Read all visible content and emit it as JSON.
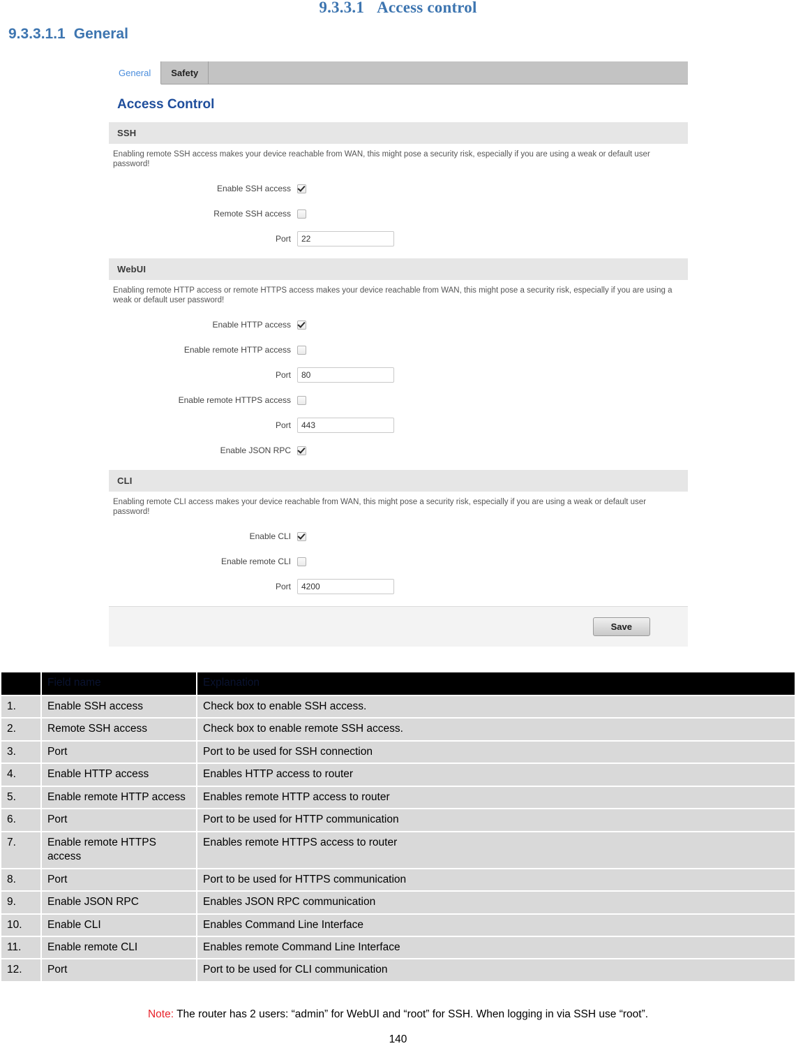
{
  "document": {
    "h1_number": "9.3.3.1",
    "h1_title": "Access control",
    "h2_number": "9.3.3.1.1",
    "h2_title": "General",
    "page_number": "140",
    "note_label": "Note:",
    "note_text": "The router has 2 users: “admin” for WebUI and “root” for SSH. When logging in via SSH use “root”."
  },
  "webui": {
    "tabs": [
      {
        "label": "General",
        "active": true
      },
      {
        "label": "Safety",
        "active": false
      }
    ],
    "panel_title": "Access Control",
    "save_label": "Save",
    "sections": [
      {
        "heading": "SSH",
        "note": "Enabling remote SSH access makes your device reachable from WAN, this might pose a security risk, especially if you are using a weak or default user password!",
        "fields": [
          {
            "label": "Enable SSH access",
            "type": "checkbox",
            "checked": true
          },
          {
            "label": "Remote SSH access",
            "type": "checkbox",
            "checked": false
          },
          {
            "label": "Port",
            "type": "text",
            "value": "22"
          }
        ]
      },
      {
        "heading": "WebUI",
        "note": "Enabling remote HTTP access or remote HTTPS access makes your device reachable from WAN, this might pose a security risk, especially if you are using a weak or default user password!",
        "fields": [
          {
            "label": "Enable HTTP access",
            "type": "checkbox",
            "checked": true
          },
          {
            "label": "Enable remote HTTP access",
            "type": "checkbox",
            "checked": false
          },
          {
            "label": "Port",
            "type": "text",
            "value": "80"
          },
          {
            "label": "Enable remote HTTPS access",
            "type": "checkbox",
            "checked": false
          },
          {
            "label": "Port",
            "type": "text",
            "value": "443"
          },
          {
            "label": "Enable JSON RPC",
            "type": "checkbox",
            "checked": true
          }
        ]
      },
      {
        "heading": "CLI",
        "note": "Enabling remote CLI access makes your device reachable from WAN, this might pose a security risk, especially if you are using a weak or default user password!",
        "fields": [
          {
            "label": "Enable CLI",
            "type": "checkbox",
            "checked": true
          },
          {
            "label": "Enable remote CLI",
            "type": "checkbox",
            "checked": false
          },
          {
            "label": "Port",
            "type": "text",
            "value": "4200"
          }
        ]
      }
    ]
  },
  "explanation_table": {
    "headers": [
      "",
      "Field name",
      "Explanation"
    ],
    "rows": [
      {
        "index": "1.",
        "field": "Enable SSH access",
        "explanation": "Check box to enable SSH access."
      },
      {
        "index": "2.",
        "field": "Remote SSH access",
        "explanation": "Check box to enable remote SSH access."
      },
      {
        "index": "3.",
        "field": "Port",
        "explanation": "Port to be used for SSH connection"
      },
      {
        "index": "4.",
        "field": "Enable HTTP access",
        "explanation": "Enables HTTP access to router"
      },
      {
        "index": "5.",
        "field": "Enable remote HTTP access",
        "explanation": "Enables remote HTTP access to router"
      },
      {
        "index": "6.",
        "field": "Port",
        "explanation": "Port to be used for HTTP communication"
      },
      {
        "index": "7.",
        "field": "Enable remote HTTPS access",
        "explanation": "Enables remote HTTPS access to router"
      },
      {
        "index": "8.",
        "field": "Port",
        "explanation": "Port to be used for HTTPS communication"
      },
      {
        "index": "9.",
        "field": "Enable JSON RPC",
        "explanation": "Enables JSON RPC communication"
      },
      {
        "index": "10.",
        "field": "Enable CLI",
        "explanation": "Enables Command Line Interface"
      },
      {
        "index": "11.",
        "field": "Enable remote CLI",
        "explanation": "Enables remote Command Line Interface"
      },
      {
        "index": "12.",
        "field": "Port",
        "explanation": "Port to be used for CLI communication"
      }
    ]
  }
}
